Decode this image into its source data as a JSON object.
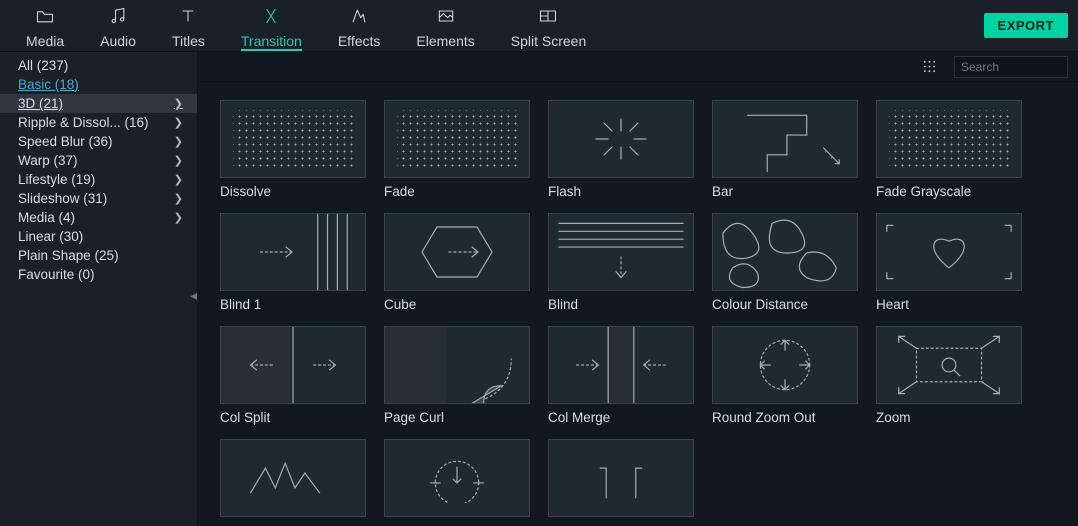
{
  "topbar": {
    "tabs": [
      {
        "label": "Media",
        "icon": "folder"
      },
      {
        "label": "Audio",
        "icon": "music"
      },
      {
        "label": "Titles",
        "icon": "titles"
      },
      {
        "label": "Transition",
        "icon": "transition",
        "active": true
      },
      {
        "label": "Effects",
        "icon": "effects"
      },
      {
        "label": "Elements",
        "icon": "elements"
      },
      {
        "label": "Split Screen",
        "icon": "split"
      }
    ],
    "export_label": "EXPORT"
  },
  "sidebar": {
    "items": [
      {
        "label": "All (237)"
      },
      {
        "label": "Basic (18)",
        "link": true
      },
      {
        "label": "3D (21)",
        "selected": true,
        "expandable": true
      },
      {
        "label": "Ripple & Dissol... (16)",
        "expandable": true
      },
      {
        "label": "Speed Blur (36)",
        "expandable": true
      },
      {
        "label": "Warp (37)",
        "expandable": true
      },
      {
        "label": "Lifestyle (19)",
        "expandable": true
      },
      {
        "label": "Slideshow (31)",
        "expandable": true
      },
      {
        "label": "Media (4)",
        "expandable": true
      },
      {
        "label": "Linear (30)"
      },
      {
        "label": "Plain Shape (25)"
      },
      {
        "label": "Favourite (0)"
      }
    ]
  },
  "search": {
    "placeholder": "Search"
  },
  "transitions": [
    {
      "name": "Dissolve",
      "thumb": "dots"
    },
    {
      "name": "Fade",
      "thumb": "dots"
    },
    {
      "name": "Flash",
      "thumb": "flash"
    },
    {
      "name": "Bar",
      "thumb": "bar"
    },
    {
      "name": "Fade Grayscale",
      "thumb": "dots"
    },
    {
      "name": "Blind 1",
      "thumb": "blind1"
    },
    {
      "name": "Cube",
      "thumb": "cube"
    },
    {
      "name": "Blind",
      "thumb": "blind"
    },
    {
      "name": "Colour Distance",
      "thumb": "blobs"
    },
    {
      "name": "Heart",
      "thumb": "heart"
    },
    {
      "name": "Col Split",
      "thumb": "colsplit"
    },
    {
      "name": "Page Curl",
      "thumb": "pagecurl"
    },
    {
      "name": "Col Merge",
      "thumb": "colmerge"
    },
    {
      "name": "Round Zoom Out",
      "thumb": "roundzoom"
    },
    {
      "name": "Zoom",
      "thumb": "zoom"
    },
    {
      "name": "",
      "thumb": "wave"
    },
    {
      "name": "",
      "thumb": "roundzoomdown"
    },
    {
      "name": "",
      "thumb": "expand"
    }
  ]
}
